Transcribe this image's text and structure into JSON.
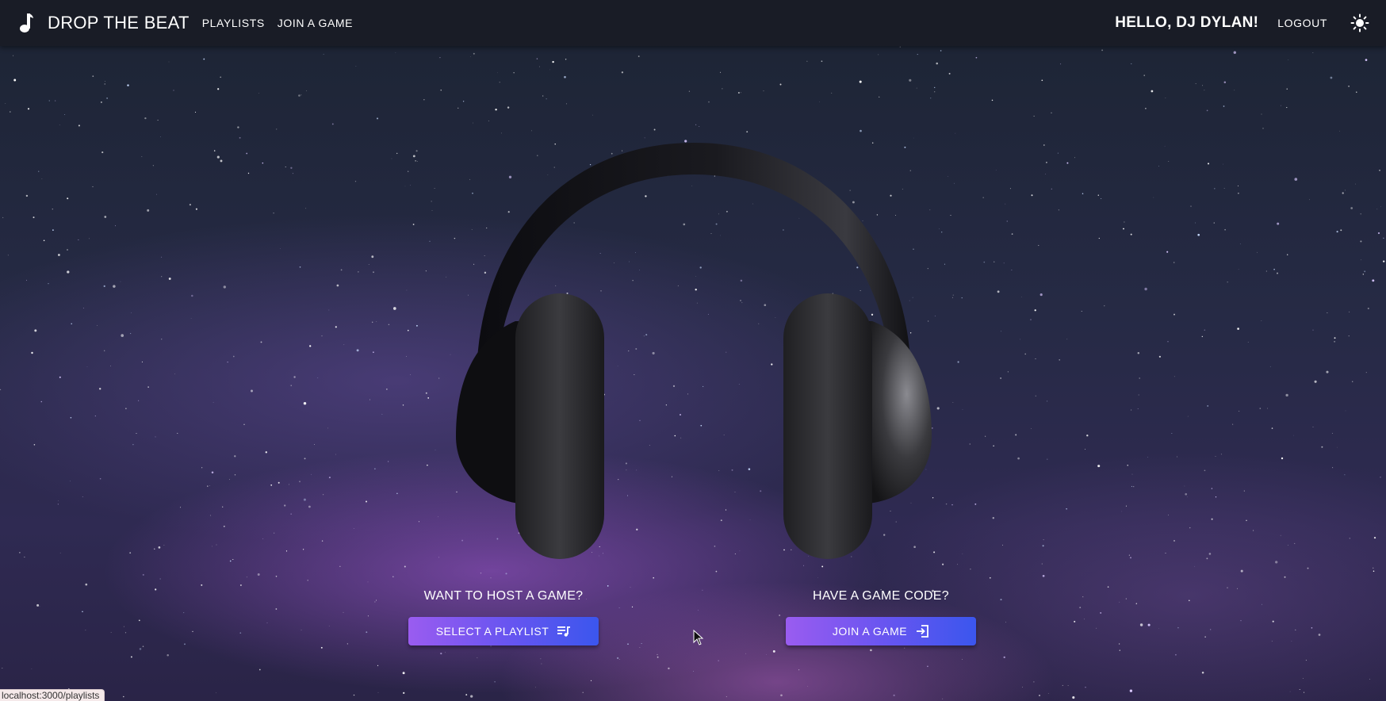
{
  "app": {
    "brand": "DROP THE BEAT",
    "logo_icon": "music-note-icon"
  },
  "nav": {
    "playlists": "PLAYLISTS",
    "join_game": "JOIN A GAME"
  },
  "user": {
    "greeting": "HELLO, DJ DYLAN!",
    "logout": "LOGOUT",
    "theme_icon": "sun-icon"
  },
  "hero": {
    "image": "headphones-icon",
    "host": {
      "label": "WANT TO HOST A GAME?",
      "button": "SELECT A PLAYLIST",
      "icon": "playlist-music-icon"
    },
    "join": {
      "label": "HAVE A GAME CODE?",
      "button": "JOIN A GAME",
      "icon": "login-icon"
    }
  },
  "status_bar": {
    "url": "localhost:3000/playlists"
  },
  "colors": {
    "button_gradient_start": "#9a5cf0",
    "button_gradient_end": "#3b56ee",
    "appbar": "#181a22"
  }
}
